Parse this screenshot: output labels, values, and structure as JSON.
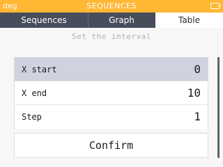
{
  "status": {
    "angle_mode": "deg",
    "title": "SEQUENCES"
  },
  "tabs": [
    {
      "label": "Sequences"
    },
    {
      "label": "Graph"
    },
    {
      "label": "Table"
    }
  ],
  "hint": "Set the interval",
  "fields": [
    {
      "label": "X start",
      "value": "0"
    },
    {
      "label": "X end",
      "value": "10"
    },
    {
      "label": "Step",
      "value": "1"
    }
  ],
  "confirm_label": "Confirm",
  "colors": {
    "accent": "#ffb734",
    "tab_bar": "#474d5a",
    "selected_row": "#cfd3df"
  },
  "icons": {
    "battery": "battery-icon"
  }
}
